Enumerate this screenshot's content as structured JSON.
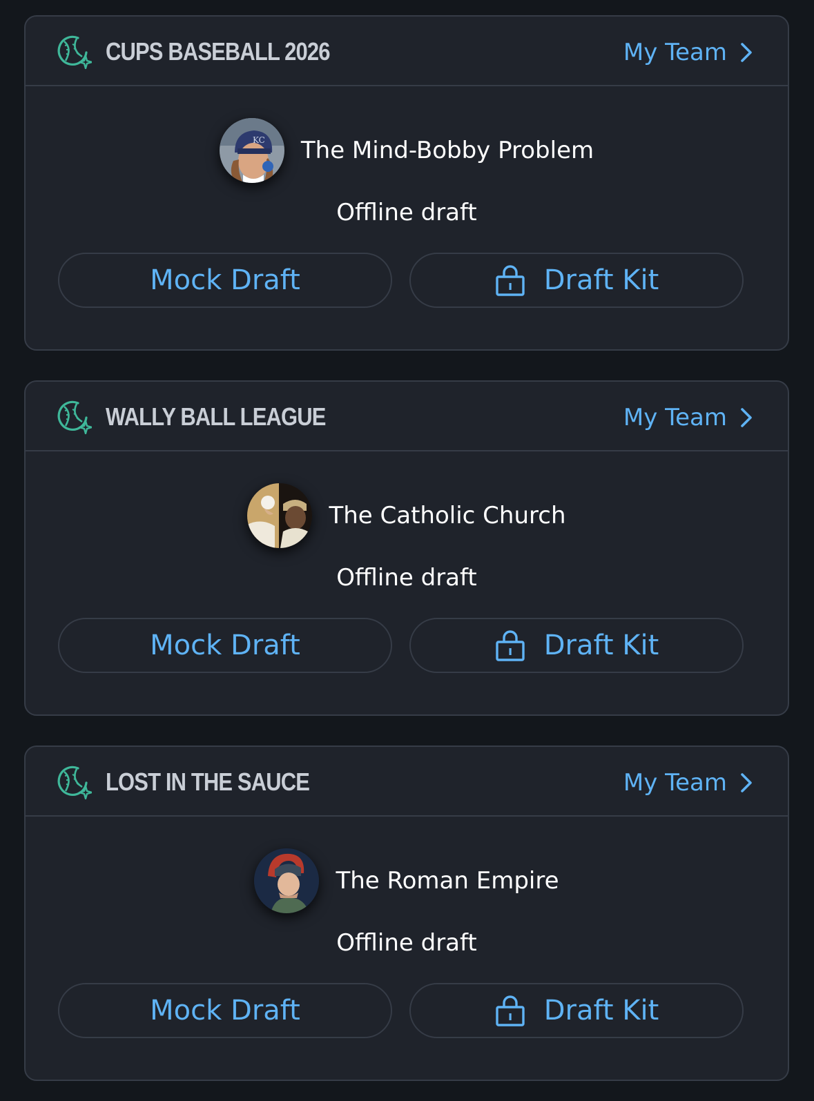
{
  "leagues": [
    {
      "name": "CUPS BASEBALL 2026",
      "my_team_label": "My Team",
      "team_name": "The Mind-Bobby Problem",
      "draft_status": "Offline draft",
      "mock_draft_label": "Mock Draft",
      "draft_kit_label": "Draft Kit"
    },
    {
      "name": "WALLY BALL LEAGUE",
      "my_team_label": "My Team",
      "team_name": "The Catholic Church",
      "draft_status": "Offline draft",
      "mock_draft_label": "Mock Draft",
      "draft_kit_label": "Draft Kit"
    },
    {
      "name": "LOST IN THE SAUCE",
      "my_team_label": "My Team",
      "team_name": "The Roman Empire",
      "draft_status": "Offline draft",
      "mock_draft_label": "Mock Draft",
      "draft_kit_label": "Draft Kit"
    }
  ],
  "icons": {
    "league": "baseball-sparkle-icon",
    "my_team": "chevron-right-icon",
    "draft_kit": "lock-icon"
  },
  "colors": {
    "background": "#13171c",
    "card": "#1f232b",
    "border": "#363c47",
    "accent": "#5fb3f5",
    "league_icon": "#3fb89a",
    "league_name": "#c9ced6",
    "text": "#ffffff"
  }
}
